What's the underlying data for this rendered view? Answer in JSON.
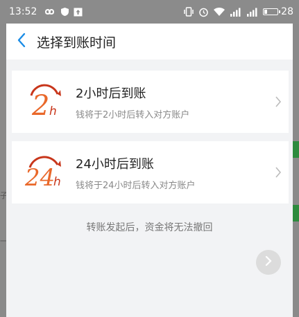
{
  "statusbar": {
    "time": "13:52",
    "battery": "28",
    "icons": [
      "infinity-icon",
      "shield-icon",
      "upload-icon",
      "vibrate-icon",
      "alarm-icon",
      "wifi-icon",
      "signal-icon",
      "signal-icon",
      "battery-icon"
    ]
  },
  "header": {
    "title": "选择到账时间"
  },
  "options": [
    {
      "title": "2小时后到账",
      "desc": "钱将于2小时后转入对方账户",
      "logo_number": "2",
      "logo_unit": "h"
    },
    {
      "title": "24小时后到账",
      "desc": "钱将于24小时后转入对方账户",
      "logo_number": "24",
      "logo_unit": "h"
    }
  ],
  "note": "转账发起后，资金将无法撤回",
  "background": {
    "left_char_1": "子",
    "left_char_2": "一"
  },
  "colors": {
    "accent": "#1a8ce6",
    "logo_orange": "#e9682a",
    "logo_red": "#c8361b"
  }
}
